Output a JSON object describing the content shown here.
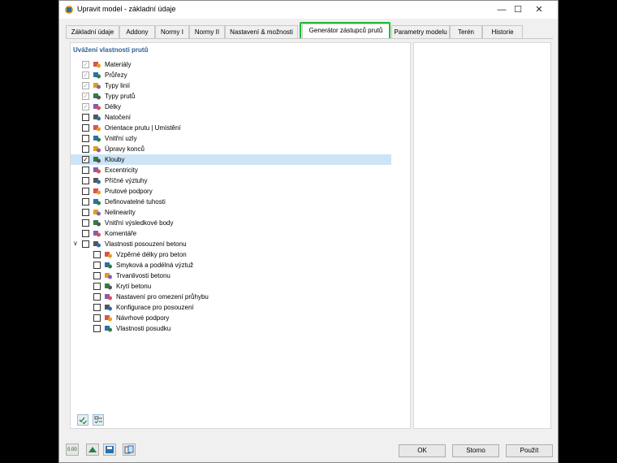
{
  "window": {
    "title": "Upravit model - základní údaje"
  },
  "tabs": [
    {
      "label": "Základní údaje"
    },
    {
      "label": "Addony"
    },
    {
      "label": "Normy I"
    },
    {
      "label": "Normy II"
    },
    {
      "label": "Nastavení & možnosti"
    },
    {
      "label": "Generátor zástupců prutů"
    },
    {
      "label": "Parametry modelu"
    },
    {
      "label": "Terén"
    },
    {
      "label": "Historie"
    }
  ],
  "active_tab": "Generátor zástupců prutů",
  "section": {
    "title": "Uvážení vlastností prutů"
  },
  "items": [
    {
      "label": "Materiály",
      "checked": true,
      "disabled": true,
      "icon": "materials-icon"
    },
    {
      "label": "Průřezy",
      "checked": true,
      "disabled": true,
      "icon": "cross-sections-icon"
    },
    {
      "label": "Typy linií",
      "checked": true,
      "disabled": true,
      "icon": "line-types-icon"
    },
    {
      "label": "Typy prutů",
      "checked": true,
      "disabled": true,
      "icon": "member-types-icon"
    },
    {
      "label": "Délky",
      "checked": true,
      "disabled": true,
      "icon": "lengths-icon"
    },
    {
      "label": "Natočení",
      "checked": false,
      "icon": "rotation-icon"
    },
    {
      "label": "Orientace prutu | Umístění",
      "checked": false,
      "icon": "orientation-icon"
    },
    {
      "label": "Vnitřní uzly",
      "checked": false,
      "icon": "internal-nodes-icon"
    },
    {
      "label": "Úpravy konců",
      "checked": false,
      "icon": "end-modifications-icon"
    },
    {
      "label": "Klouby",
      "checked": true,
      "selected": true,
      "icon": "hinges-icon"
    },
    {
      "label": "Excentricity",
      "checked": false,
      "icon": "eccentricities-icon"
    },
    {
      "label": "Příčné výztuhy",
      "checked": false,
      "icon": "transverse-stiffeners-icon"
    },
    {
      "label": "Prutové podpory",
      "checked": false,
      "icon": "member-supports-icon"
    },
    {
      "label": "Definovatelné tuhosti",
      "checked": false,
      "icon": "definable-stiffness-icon"
    },
    {
      "label": "Nelinearity",
      "checked": false,
      "icon": "nonlinearity-icon"
    },
    {
      "label": "Vnitřní výsledkové body",
      "checked": false,
      "icon": "result-points-icon"
    },
    {
      "label": "Komentáře",
      "checked": false,
      "icon": "comments-icon"
    },
    {
      "label": "Vlastnosti posouzení betonu",
      "checked": false,
      "expanded": true,
      "icon": "concrete-design-icon"
    },
    {
      "label": "Vzpěrné délky pro beton",
      "checked": false,
      "child": true,
      "icon": "buckling-lengths-icon"
    },
    {
      "label": "Smyková a podélná výztuž",
      "checked": false,
      "child": true,
      "icon": "shear-reinforcement-icon"
    },
    {
      "label": "Trvanlivosti betonu",
      "checked": false,
      "child": true,
      "icon": "durability-icon"
    },
    {
      "label": "Krytí betonu",
      "checked": false,
      "child": true,
      "icon": "concrete-cover-icon"
    },
    {
      "label": "Nastavení pro omezení průhybu",
      "checked": false,
      "child": true,
      "icon": "deflection-icon"
    },
    {
      "label": "Konfigurace pro posouzení",
      "checked": false,
      "child": true,
      "icon": "design-config-icon"
    },
    {
      "label": "Návrhové podpory",
      "checked": false,
      "child": true,
      "icon": "design-supports-icon"
    },
    {
      "label": "Vlastnosti posudku",
      "checked": false,
      "child": true,
      "icon": "design-properties-icon"
    }
  ],
  "footer": {
    "ok_label": "OK",
    "cancel_label": "Storno",
    "apply_label": "Použít",
    "units_label": "0.00"
  }
}
